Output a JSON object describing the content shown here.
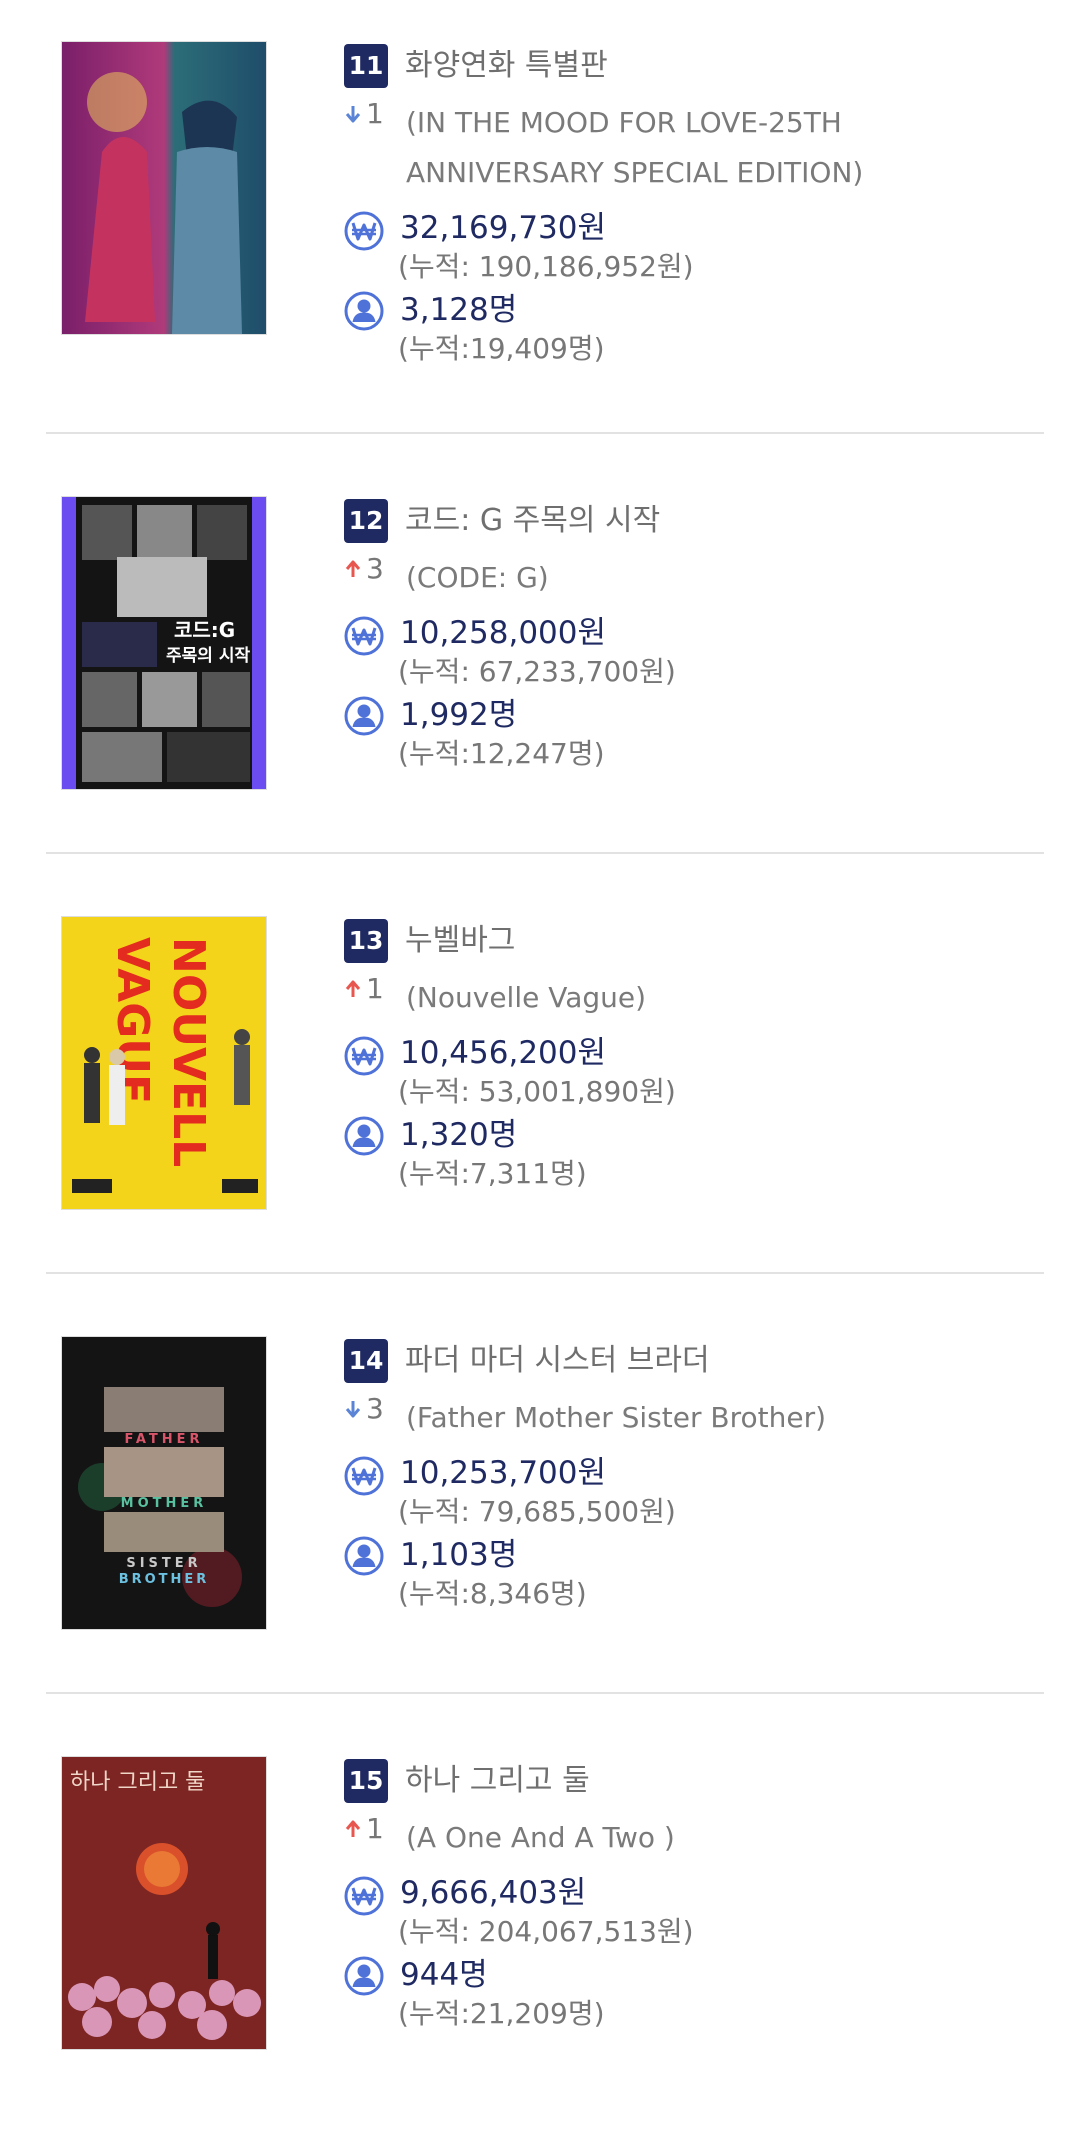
{
  "colors": {
    "badge": "#1f2a62",
    "value_text": "#1f2a62",
    "muted_text": "#777777",
    "arrow_up": "#e8574f",
    "arrow_down": "#5b84d6",
    "icon_blue": "#4f72d9",
    "divider": "#e2e2e2"
  },
  "icons": {
    "revenue": "won-currency-icon",
    "audience": "person-icon"
  },
  "entries": [
    {
      "rank": "11",
      "title_ko": "화양연화 특별판",
      "change": {
        "direction": "down",
        "value": "1"
      },
      "title_en": "(IN THE MOOD FOR LOVE-25TH ANNIVERSARY SPECIAL EDITION)",
      "revenue": "32,169,730원",
      "revenue_total": "(누적: 190,186,952원)",
      "audience": "3,128명",
      "audience_total": "(누적:19,409명)",
      "poster_style": "mood"
    },
    {
      "rank": "12",
      "title_ko": "코드: G 주목의 시작",
      "change": {
        "direction": "up",
        "value": "3"
      },
      "title_en": "(CODE: G)",
      "revenue": "10,258,000원",
      "revenue_total": "(누적: 67,233,700원)",
      "audience": "1,992명",
      "audience_total": "(누적:12,247명)",
      "poster_style": "codeg",
      "poster_text": "코드:G 주목의 시작"
    },
    {
      "rank": "13",
      "title_ko": "누벨바그",
      "change": {
        "direction": "up",
        "value": "1"
      },
      "title_en": "(Nouvelle Vague)",
      "revenue": "10,456,200원",
      "revenue_total": "(누적: 53,001,890원)",
      "audience": "1,320명",
      "audience_total": "(누적:7,311명)",
      "poster_style": "vague",
      "poster_text": "NOUVELLE VAGUE"
    },
    {
      "rank": "14",
      "title_ko": "파더 마더 시스터 브라더",
      "change": {
        "direction": "down",
        "value": "3"
      },
      "title_en": "(Father Mother Sister Brother)",
      "revenue": "10,253,700원",
      "revenue_total": "(누적: 79,685,500원)",
      "audience": "1,103명",
      "audience_total": "(누적:8,346명)",
      "poster_style": "father",
      "poster_text": "FATHER MOTHER SISTER BROTHER"
    },
    {
      "rank": "15",
      "title_ko": "하나 그리고 둘",
      "change": {
        "direction": "up",
        "value": "1"
      },
      "title_en": "(A One And A Two )",
      "revenue": "9,666,403원",
      "revenue_total": "(누적: 204,067,513원)",
      "audience": "944명",
      "audience_total": "(누적:21,209명)",
      "poster_style": "yiyi",
      "poster_text": "하나 그리고 둘"
    }
  ]
}
